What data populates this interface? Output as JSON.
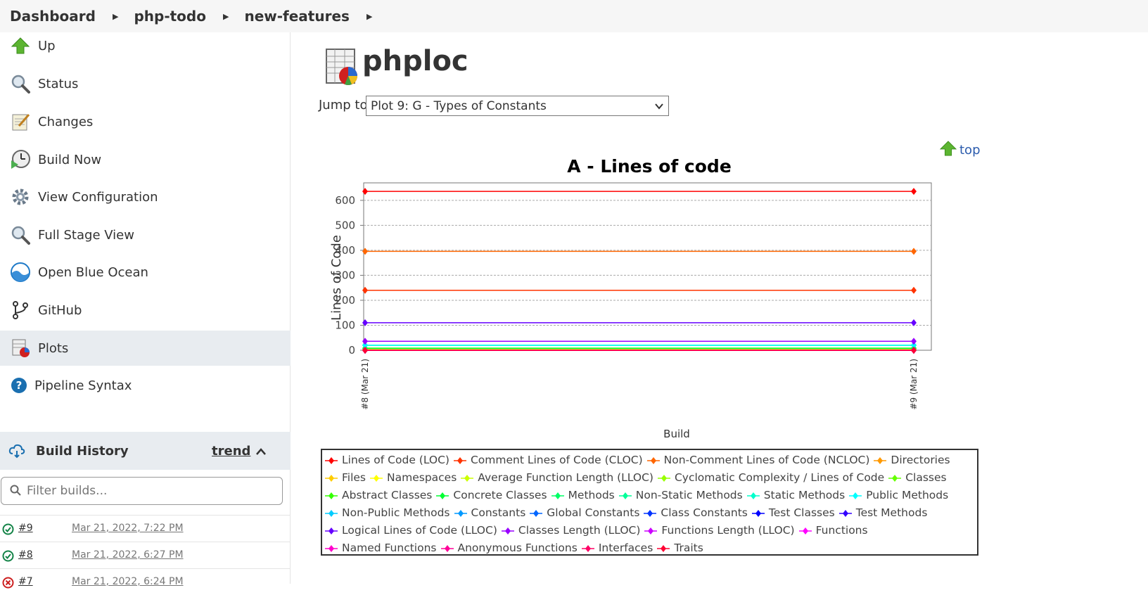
{
  "breadcrumb": {
    "items": [
      "Dashboard",
      "php-todo",
      "new-features"
    ]
  },
  "sidebar": {
    "items": [
      {
        "label": "Up",
        "icon": "up-arrow-icon"
      },
      {
        "label": "Status",
        "icon": "magnifier-icon"
      },
      {
        "label": "Changes",
        "icon": "notepad-icon"
      },
      {
        "label": "Build Now",
        "icon": "clock-play-icon"
      },
      {
        "label": "View Configuration",
        "icon": "gear-icon"
      },
      {
        "label": "Full Stage View",
        "icon": "magnifier-icon"
      },
      {
        "label": "Open Blue Ocean",
        "icon": "blue-ocean-icon"
      },
      {
        "label": "GitHub",
        "icon": "git-branch-icon"
      },
      {
        "label": "Plots",
        "icon": "plot-icon"
      },
      {
        "label": "Pipeline Syntax",
        "icon": "help-icon"
      }
    ],
    "active": "Plots"
  },
  "build_history": {
    "title": "Build History",
    "trend_label": "trend",
    "filter_placeholder": "Filter builds...",
    "builds": [
      {
        "number": "#9",
        "date": "Mar 21, 2022, 7:22 PM",
        "status": "success"
      },
      {
        "number": "#8",
        "date": "Mar 21, 2022, 6:27 PM",
        "status": "success"
      },
      {
        "number": "#7",
        "date": "Mar 21, 2022, 6:24 PM",
        "status": "failed"
      }
    ]
  },
  "main": {
    "title": "phploc",
    "jump_label": "Jump to",
    "jump_selected": "Plot 9: G - Types of Constants",
    "top_label": "top"
  },
  "chart_data": {
    "type": "line",
    "title": "A - Lines of code",
    "xlabel": "Build",
    "ylabel": "Lines of Code",
    "categories": [
      "#8 (Mar 21)",
      "#9 (Mar 21)"
    ],
    "ylim": [
      0,
      670
    ],
    "yticks": [
      0,
      100,
      200,
      300,
      400,
      500,
      600
    ],
    "grid": true,
    "legend_position": "bottom",
    "series": [
      {
        "name": "Lines of Code (LOC)",
        "color": "#ff0000",
        "values": [
          636,
          636
        ]
      },
      {
        "name": "Comment Lines of Code (CLOC)",
        "color": "#ff3300",
        "values": [
          240,
          240
        ]
      },
      {
        "name": "Non-Comment Lines of Code (NCLOC)",
        "color": "#ff6600",
        "values": [
          396,
          396
        ]
      },
      {
        "name": "Directories",
        "color": "#ff9900",
        "values": [
          2,
          2
        ]
      },
      {
        "name": "Files",
        "color": "#ffcc00",
        "values": [
          8,
          8
        ]
      },
      {
        "name": "Namespaces",
        "color": "#ffff00",
        "values": [
          0,
          0
        ]
      },
      {
        "name": "Average Function Length (LLOC)",
        "color": "#ccff00",
        "values": [
          3,
          3
        ]
      },
      {
        "name": "Cyclomatic Complexity / Lines of Code",
        "color": "#99ff00",
        "values": [
          0,
          0
        ]
      },
      {
        "name": "Classes",
        "color": "#66ff00",
        "values": [
          8,
          8
        ]
      },
      {
        "name": "Abstract Classes",
        "color": "#33ff00",
        "values": [
          0,
          0
        ]
      },
      {
        "name": "Concrete Classes",
        "color": "#00ff33",
        "values": [
          8,
          8
        ]
      },
      {
        "name": "Methods",
        "color": "#00ff66",
        "values": [
          20,
          20
        ]
      },
      {
        "name": "Non-Static Methods",
        "color": "#00ff99",
        "values": [
          20,
          20
        ]
      },
      {
        "name": "Static Methods",
        "color": "#00ffcc",
        "values": [
          0,
          0
        ]
      },
      {
        "name": "Public Methods",
        "color": "#00ffff",
        "values": [
          20,
          20
        ]
      },
      {
        "name": "Non-Public Methods",
        "color": "#00ccff",
        "values": [
          0,
          0
        ]
      },
      {
        "name": "Constants",
        "color": "#0099ff",
        "values": [
          0,
          0
        ]
      },
      {
        "name": "Global Constants",
        "color": "#0066ff",
        "values": [
          0,
          0
        ]
      },
      {
        "name": "Class Constants",
        "color": "#0033ff",
        "values": [
          0,
          0
        ]
      },
      {
        "name": "Test Classes",
        "color": "#0000ff",
        "values": [
          0,
          0
        ]
      },
      {
        "name": "Test Methods",
        "color": "#3300ff",
        "values": [
          0,
          0
        ]
      },
      {
        "name": "Logical Lines of Code (LLOC)",
        "color": "#6600ff",
        "values": [
          110,
          110
        ]
      },
      {
        "name": "Classes Length (LLOC)",
        "color": "#9900ff",
        "values": [
          36,
          36
        ]
      },
      {
        "name": "Functions Length (LLOC)",
        "color": "#cc00ff",
        "values": [
          0,
          0
        ]
      },
      {
        "name": "Functions",
        "color": "#ff00ff",
        "values": [
          0,
          0
        ]
      },
      {
        "name": "Named Functions",
        "color": "#ff00cc",
        "values": [
          0,
          0
        ]
      },
      {
        "name": "Anonymous Functions",
        "color": "#ff0099",
        "values": [
          0,
          0
        ]
      },
      {
        "name": "Interfaces",
        "color": "#ff0066",
        "values": [
          0,
          0
        ]
      },
      {
        "name": "Traits",
        "color": "#ff0033",
        "values": [
          0,
          0
        ]
      }
    ]
  }
}
